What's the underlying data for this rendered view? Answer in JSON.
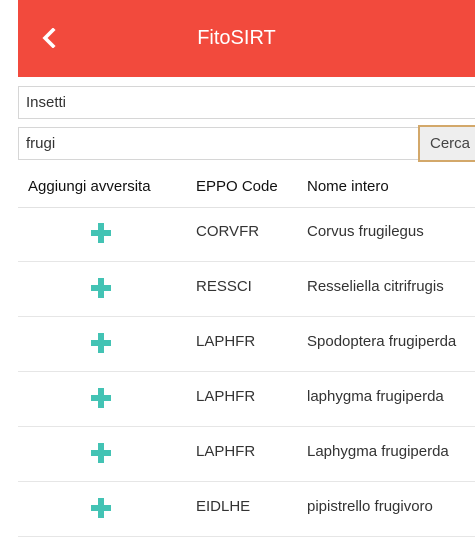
{
  "header": {
    "title": "FitoSIRT",
    "back_icon": "chevron-left-icon",
    "color": "#f24a3d"
  },
  "form": {
    "category_value": "Insetti",
    "search_value": "frugi",
    "search_button_label": "Cerca"
  },
  "table": {
    "columns": [
      "Aggiungi avversita",
      "EPPO Code",
      "Nome intero"
    ],
    "add_icon": "plus-icon",
    "add_color": "#43c3b4",
    "rows": [
      {
        "eppo": "CORVFR",
        "name": "Corvus frugilegus"
      },
      {
        "eppo": "RESSCI",
        "name": "Resseliella citrifrugis"
      },
      {
        "eppo": "LAPHFR",
        "name": "Spodoptera frugiperda"
      },
      {
        "eppo": "LAPHFR",
        "name": "laphygma frugiperda"
      },
      {
        "eppo": "LAPHFR",
        "name": "Laphygma frugiperda"
      },
      {
        "eppo": "EIDLHE",
        "name": "pipistrello frugivoro"
      }
    ]
  }
}
